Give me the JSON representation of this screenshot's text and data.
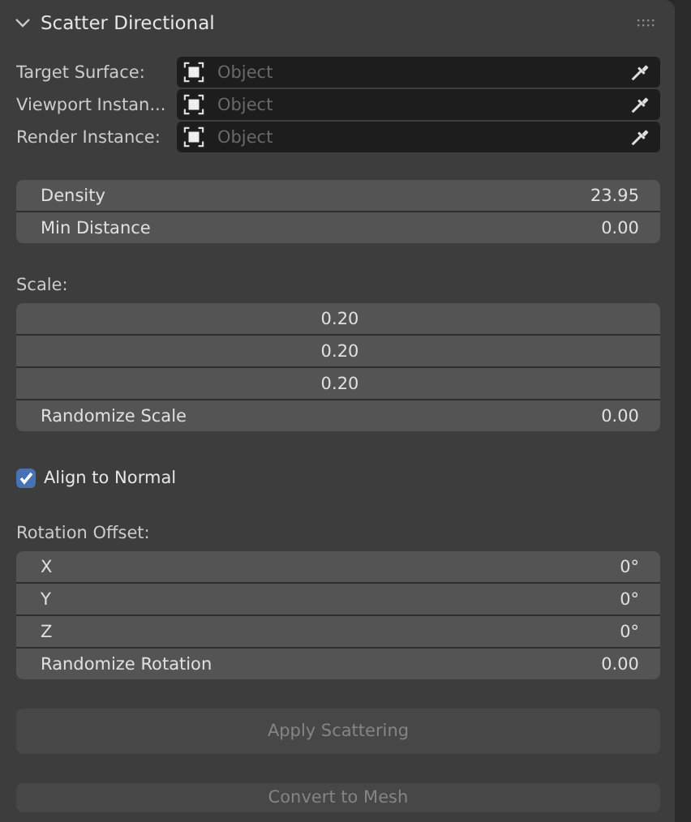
{
  "panel": {
    "title": "Scatter Directional",
    "expanded": true
  },
  "object_fields": [
    {
      "label": "Target Surface:",
      "placeholder": "Object"
    },
    {
      "label": "Viewport Instan...",
      "placeholder": "Object"
    },
    {
      "label": "Render Instance:",
      "placeholder": "Object"
    }
  ],
  "distribution": [
    {
      "label": "Density",
      "value": "23.95"
    },
    {
      "label": "Min Distance",
      "value": "0.00"
    }
  ],
  "scale": {
    "label": "Scale:",
    "fields": [
      {
        "value": "0.20"
      },
      {
        "value": "0.20"
      },
      {
        "value": "0.20"
      },
      {
        "label": "Randomize Scale",
        "value": "0.00"
      }
    ]
  },
  "align_to_normal": {
    "label": "Align to Normal",
    "checked": true
  },
  "rotation": {
    "label": "Rotation Offset:",
    "fields": [
      {
        "label": "X",
        "value": "0°"
      },
      {
        "label": "Y",
        "value": "0°"
      },
      {
        "label": "Z",
        "value": "0°"
      },
      {
        "label": "Randomize Rotation",
        "value": "0.00"
      }
    ]
  },
  "buttons": [
    {
      "label": "Apply Scattering",
      "disabled": true,
      "kind": "large"
    },
    {
      "label": "Convert to Mesh",
      "disabled": true,
      "kind": "small"
    }
  ]
}
